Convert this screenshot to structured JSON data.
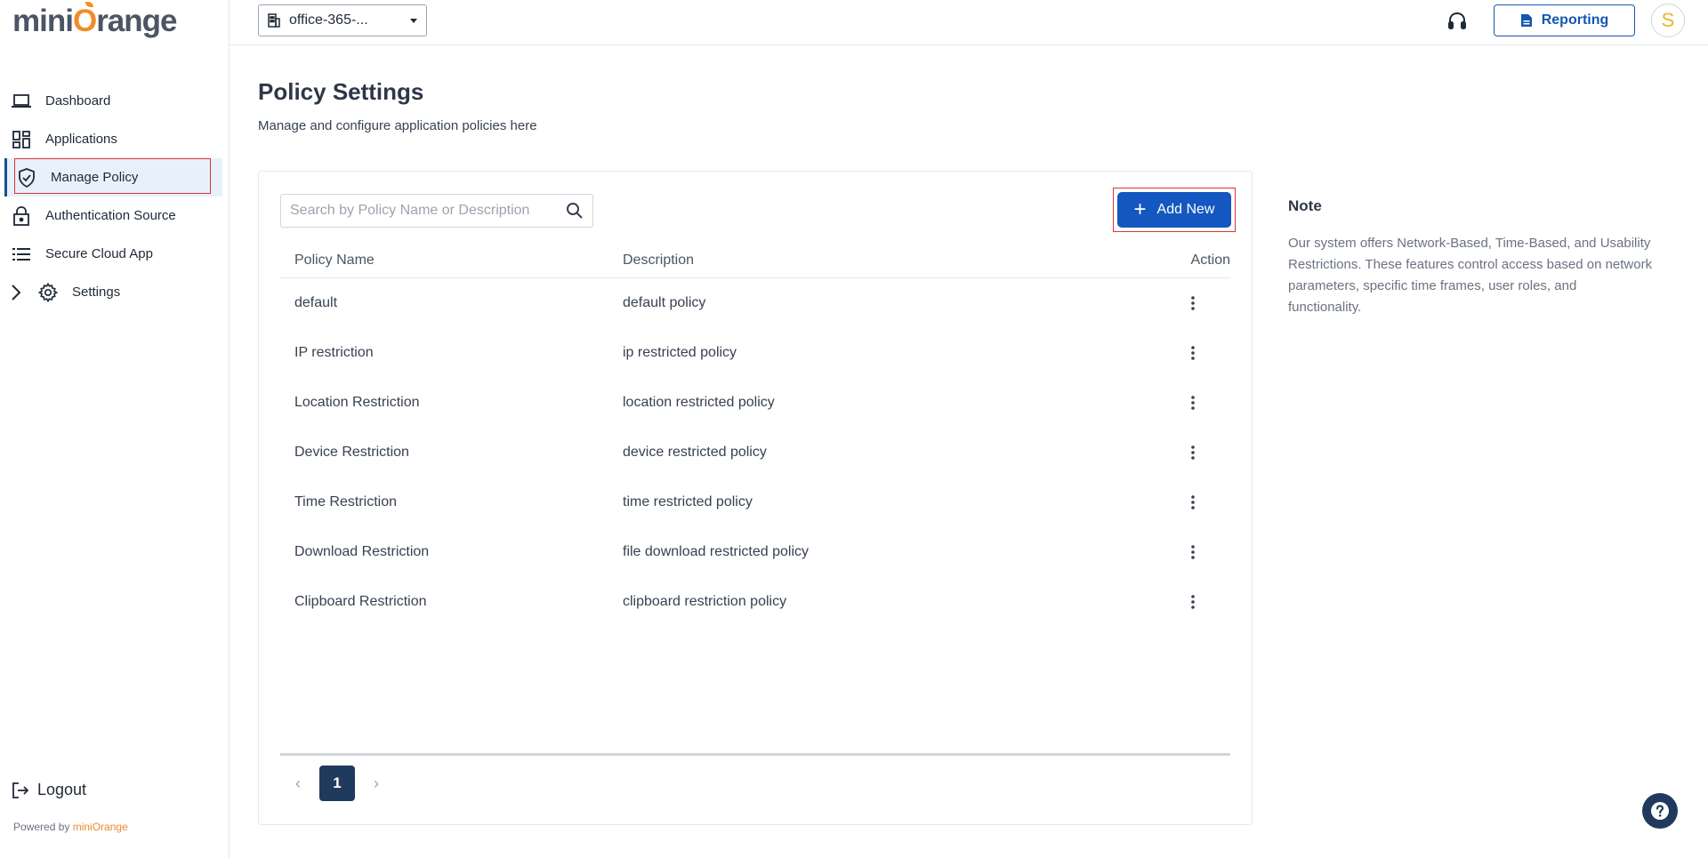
{
  "brand": {
    "logo_prefix": "mini",
    "logo_o": "O",
    "logo_suffix": "range",
    "powered_by_label": "Powered by",
    "powered_by_brand": "miniOrange",
    "accent": "#f28c28"
  },
  "sidebar": {
    "items": [
      {
        "label": "Dashboard",
        "icon": "laptop-icon"
      },
      {
        "label": "Applications",
        "icon": "grid-icon"
      },
      {
        "label": "Manage Policy",
        "icon": "shield-check-icon",
        "active": true
      },
      {
        "label": "Authentication Source",
        "icon": "lock-icon"
      },
      {
        "label": "Secure Cloud App",
        "icon": "list-icon"
      },
      {
        "label": "Settings",
        "icon": "gear-icon"
      }
    ],
    "logout_label": "Logout"
  },
  "topbar": {
    "org_select_value": "office-365-...",
    "reporting_label": "Reporting",
    "avatar_initial": "S"
  },
  "page": {
    "title": "Policy Settings",
    "subtitle": "Manage and configure application policies here"
  },
  "search": {
    "placeholder": "Search by Policy Name or Description",
    "value": ""
  },
  "actions": {
    "add_new_label": "Add New"
  },
  "table": {
    "headers": {
      "name": "Policy Name",
      "description": "Description",
      "action": "Action"
    },
    "rows": [
      {
        "name": "default",
        "description": "default policy"
      },
      {
        "name": "IP restriction",
        "description": "ip restricted policy"
      },
      {
        "name": "Location Restriction",
        "description": "location restricted policy"
      },
      {
        "name": "Device Restriction",
        "description": "device restricted policy"
      },
      {
        "name": "Time Restriction",
        "description": "time restricted policy"
      },
      {
        "name": "Download Restriction",
        "description": "file download restricted policy"
      },
      {
        "name": "Clipboard Restriction",
        "description": "clipboard restriction policy"
      }
    ]
  },
  "pagination": {
    "current_page": "1",
    "prev_symbol": "‹",
    "next_symbol": "›"
  },
  "note": {
    "title": "Note",
    "body": "Our system offers Network-Based, Time-Based, and Usability Restrictions. These features control access based on network parameters, specific time frames, user roles, and functionality."
  },
  "colors": {
    "primary": "#1557c0",
    "dark_navy": "#1f3a5c",
    "highlight_border": "#e03131",
    "active_bg": "#e8f1fb"
  }
}
